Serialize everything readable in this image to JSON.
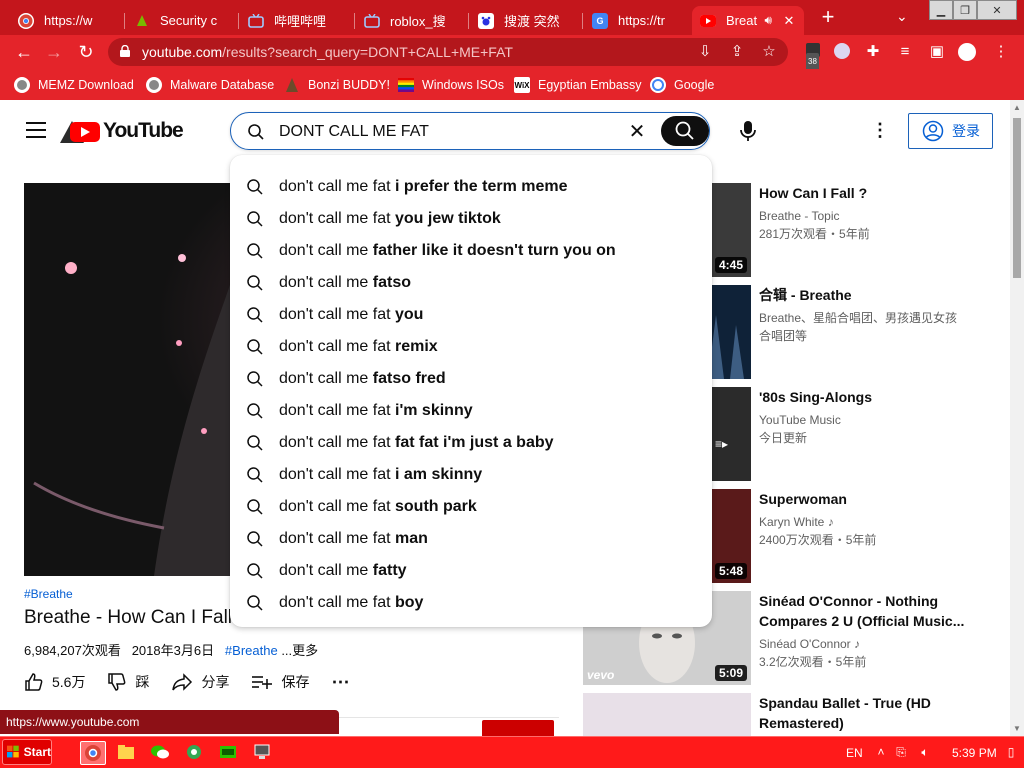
{
  "tabs": [
    {
      "title": "https://w",
      "icon": "chrome-icon"
    },
    {
      "title": "Security c",
      "icon": "security-icon"
    },
    {
      "title": "哔哩哔哩",
      "icon": "bilibili-icon"
    },
    {
      "title": "roblox_搜",
      "icon": "bilibili-icon"
    },
    {
      "title": "搜渡 突然",
      "icon": "baidu-icon"
    },
    {
      "title": "https://tr",
      "icon": "translate-icon"
    },
    {
      "title": "Breat",
      "icon": "youtube-icon",
      "active": true
    }
  ],
  "toolbar": {
    "url_host": "youtube.com",
    "url_path": "/results?search_query=DONT+CALL+ME+FAT",
    "extension_badge": "38"
  },
  "bookmarks": [
    {
      "label": "MEMZ Download"
    },
    {
      "label": "Malware Database"
    },
    {
      "label": "Bonzi BUDDY!"
    },
    {
      "label": "Windows ISOs"
    },
    {
      "label": "Egyptian Embassy"
    },
    {
      "label": "Google"
    }
  ],
  "youtube": {
    "logo": "YouTube",
    "search_value": "DONT CALL ME FAT",
    "signin_label": "登录",
    "suggestions": [
      {
        "typed": "don't call me fat",
        "rest": " i prefer the term meme"
      },
      {
        "typed": "don't call me fat",
        "rest": " you jew tiktok"
      },
      {
        "typed": "don't call me",
        "rest": " father like it doesn't turn you on"
      },
      {
        "typed": "don't call me",
        "rest": " fatso"
      },
      {
        "typed": "don't call me fat",
        "rest": " you"
      },
      {
        "typed": "don't call me fat",
        "rest": " remix"
      },
      {
        "typed": "don't call me",
        "rest": " fatso fred"
      },
      {
        "typed": "don't call me fat",
        "rest": " i'm skinny"
      },
      {
        "typed": "don't call me fat",
        "rest": " fat fat i'm just a baby"
      },
      {
        "typed": "don't call me fat",
        "rest": " i am skinny"
      },
      {
        "typed": "don't call me fat",
        "rest": " south park"
      },
      {
        "typed": "don't call me fat",
        "rest": " man"
      },
      {
        "typed": "don't call me",
        "rest": " fatty"
      },
      {
        "typed": "don't call me fat",
        "rest": " boy"
      }
    ],
    "video": {
      "hashtag": "#Breathe",
      "title": "Breathe - How Can I Fall",
      "views": "6,984,207次观看",
      "date": "2018年3月6日",
      "hashtag_inline": "#Breathe",
      "more": "...更多",
      "likes": "5.6万",
      "dislike_label": "踩",
      "share_label": "分享",
      "save_label": "保存"
    },
    "recommendations": [
      {
        "title": "How Can I Fall ?",
        "channel": "Breathe - Topic",
        "stats": "281万次观看・5年前",
        "duration": "4:45",
        "thumb_color": "#3a3a3a"
      },
      {
        "title": "合辑 - Breathe",
        "channel": "Breathe、星船合唱团、男孩遇见女孩合唱团等",
        "stats": "",
        "duration": "",
        "thumb_color": "#1f3a5c"
      },
      {
        "title": "'80s Sing-Alongs",
        "channel": "YouTube Music",
        "stats": "今日更新",
        "duration": "",
        "thumb_color": "#2b2b2b"
      },
      {
        "title": "Superwoman",
        "channel": "Karyn White ♪",
        "stats": "2400万次观看・5年前",
        "duration": "5:48",
        "thumb_color": "#5a1a1a"
      },
      {
        "title": "Sinéad O'Connor - Nothing Compares 2 U (Official Music...",
        "channel": "Sinéad O'Connor ♪",
        "stats": "3.2亿次观看・5年前",
        "duration": "5:09",
        "thumb_color": "#bdbdbd"
      },
      {
        "title": "Spandau Ballet - True (HD Remastered)",
        "channel": "",
        "stats": "",
        "duration": "",
        "thumb_color": "#e8e0e8"
      }
    ]
  },
  "status_url": "https://www.youtube.com",
  "taskbar": {
    "start_label": "Start",
    "language": "EN",
    "time": "5:39 PM"
  },
  "colors": {
    "chrome_red": "#e4242a",
    "tabstrip_red": "#c4161c",
    "taskbar_red": "#ff1a1a",
    "link_blue": "#065fd4"
  }
}
